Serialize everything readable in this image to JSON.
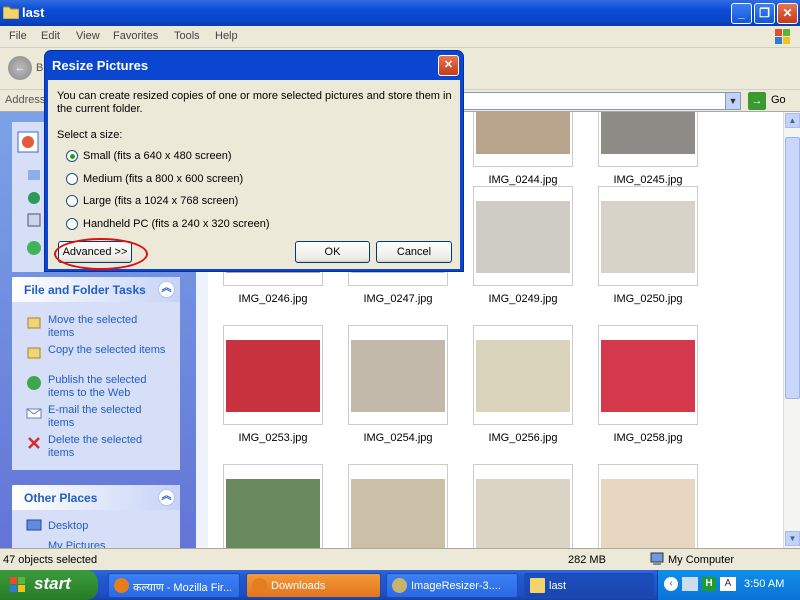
{
  "window": {
    "title": "last"
  },
  "menu": [
    "File",
    "Edit",
    "View",
    "Favorites",
    "Tools",
    "Help"
  ],
  "toolbar": {
    "back_label": "B"
  },
  "address": {
    "label": "Address",
    "value": "",
    "go_label": "Go"
  },
  "tasks": {
    "title": "File and Folder Tasks",
    "items": [
      "Move the selected items",
      "Copy the selected items",
      "Publish the selected items to the Web",
      "E-mail the selected items",
      "Delete the selected items"
    ]
  },
  "other_places": {
    "title": "Other Places",
    "items": [
      "Desktop",
      "My Pictures"
    ]
  },
  "files": [
    {
      "name": "IMG_0244.jpg",
      "color": "#b9a58e"
    },
    {
      "name": "IMG_0245.jpg",
      "color": "#8d8b85"
    },
    {
      "name": "IMG_0246.jpg",
      "color": "#bca58a"
    },
    {
      "name": "IMG_0247.jpg",
      "color": "#c4c1bb"
    },
    {
      "name": "IMG_0249.jpg",
      "color": "#cfccc5"
    },
    {
      "name": "IMG_0250.jpg",
      "color": "#d8d3c8"
    },
    {
      "name": "IMG_0253.jpg",
      "color": "#c9323f"
    },
    {
      "name": "IMG_0254.jpg",
      "color": "#c2b9aa"
    },
    {
      "name": "IMG_0256.jpg",
      "color": "#d8d3ba"
    },
    {
      "name": "IMG_0258.jpg",
      "color": "#d43a4b"
    },
    {
      "name": "",
      "color": "#6a8a5d"
    },
    {
      "name": "",
      "color": "#cbbfa7"
    },
    {
      "name": "",
      "color": "#d9d4c4"
    },
    {
      "name": "",
      "color": "#e7d6c0"
    }
  ],
  "status": {
    "selected": "47 objects selected",
    "size": "282 MB",
    "location": "My Computer"
  },
  "taskbar": {
    "start": "start",
    "buttons": [
      "कल्याण - Mozilla Fir...",
      "Downloads",
      "ImageResizer-3....",
      "last"
    ],
    "clock": "3:50 AM"
  },
  "dialog": {
    "title": "Resize Pictures",
    "text": "You can create resized copies of one or more selected pictures and store them in the current folder.",
    "select_label": "Select a size:",
    "options": [
      {
        "label": "Small (fits a 640 x 480 screen)",
        "selected": true
      },
      {
        "label": "Medium (fits a 800 x 600 screen)",
        "selected": false
      },
      {
        "label": "Large (fits a 1024 x 768 screen)",
        "selected": false
      },
      {
        "label": "Handheld PC (fits a 240 x 320 screen)",
        "selected": false
      }
    ],
    "advanced": "Advanced >>",
    "ok": "OK",
    "cancel": "Cancel"
  }
}
